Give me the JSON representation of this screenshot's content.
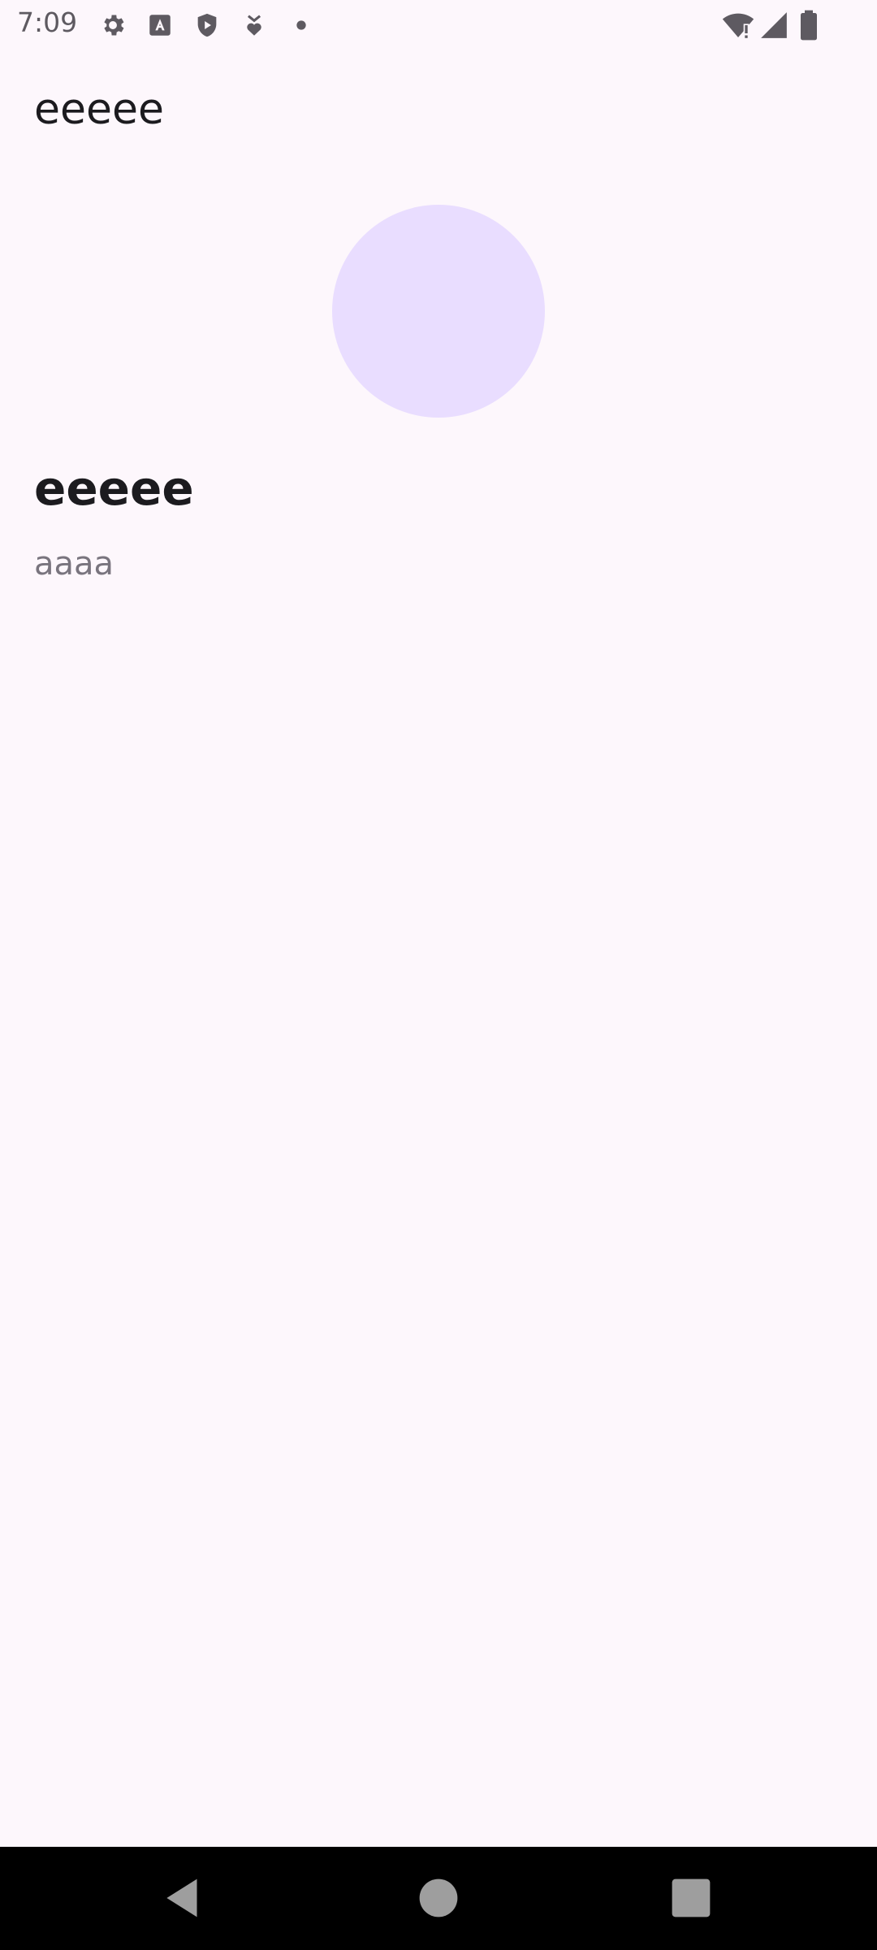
{
  "status_bar": {
    "time": "7:09",
    "icons_left": [
      "gear-icon",
      "text-a-icon",
      "shield-play-icon",
      "download-heart-icon",
      "dot-icon"
    ],
    "icons_right": [
      "wifi-alert-icon",
      "signal-icon",
      "battery-icon"
    ],
    "icon_color": "#5e5a61"
  },
  "app_bar": {
    "title": "eeeee"
  },
  "profile": {
    "avatar_color": "#e9ddff",
    "name": "eeeee",
    "subtitle": "aaaa"
  },
  "nav_bar": {
    "buttons": [
      "back-icon",
      "home-icon",
      "recents-icon"
    ],
    "icon_color": "#9e9e9e"
  },
  "colors": {
    "background": "#fdf7fc",
    "text_primary": "#1c1b1f",
    "text_secondary": "#79747e"
  }
}
